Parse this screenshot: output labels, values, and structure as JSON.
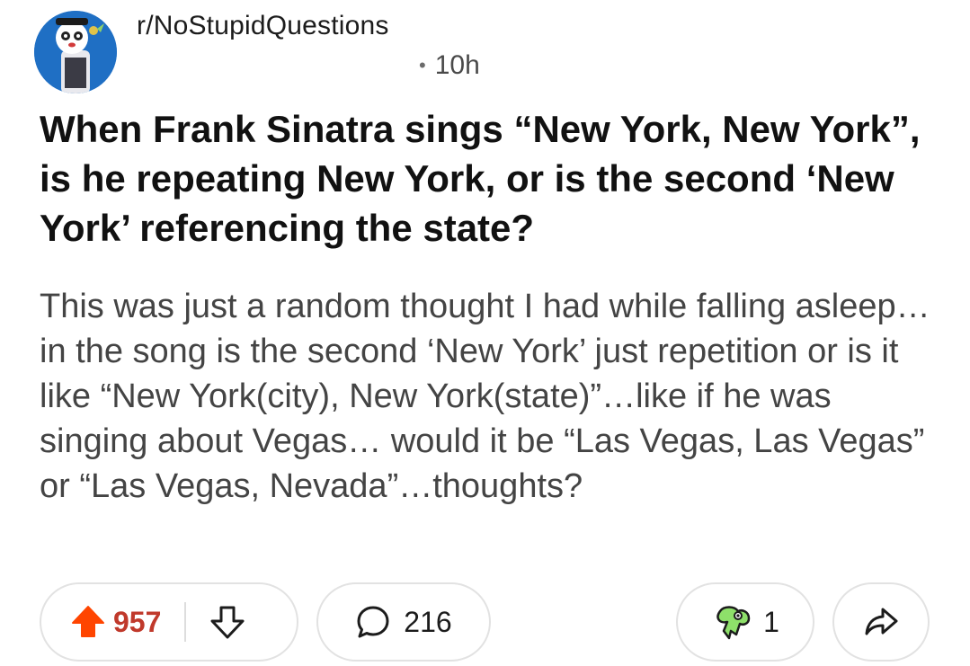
{
  "post": {
    "subreddit": "r/NoStupidQuestions",
    "age": "10h",
    "title": "When Frank Sinatra sings “New York, New York”, is he repeating New York, or is the second ‘New York’ referencing the state?",
    "body": "This was just a random thought I had while falling asleep…in the song is the second ‘New York’ just repetition or is it like “New York(city), New York(state)”…like if he was singing about Vegas… would it be “Las Vegas, Las Vegas” or “Las Vegas, Nevada”…thoughts?"
  },
  "actions": {
    "upvotes": "957",
    "comments": "216",
    "awards": "1"
  },
  "icons": {
    "upvote": "upvote-arrow-icon",
    "downvote": "downvote-arrow-icon",
    "comment": "comment-bubble-icon",
    "award": "award-icon",
    "share": "share-arrow-icon"
  },
  "colors": {
    "upvote": "#ff4500",
    "upvote_text": "#c0392b",
    "avatar_bg": "#1f6fc4",
    "award": "#8ee06a"
  }
}
